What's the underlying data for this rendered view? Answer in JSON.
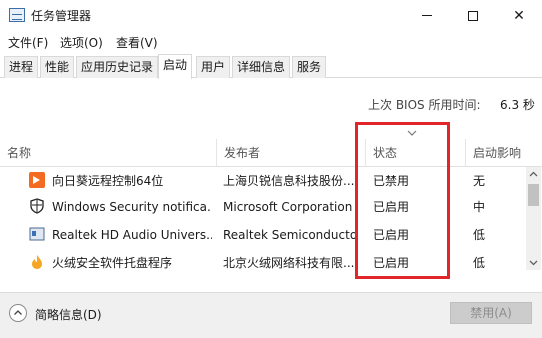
{
  "window": {
    "title": "任务管理器"
  },
  "menu": [
    "文件(F)",
    "选项(O)",
    "查看(V)"
  ],
  "tabs": [
    "进程",
    "性能",
    "应用历史记录",
    "启动",
    "用户",
    "详细信息",
    "服务"
  ],
  "active_tab": "启动",
  "boot": {
    "label": "上次 BIOS 所用时间:",
    "value": "6.3 秒"
  },
  "columns": {
    "name": "名称",
    "publisher": "发布者",
    "status": "状态",
    "impact": "启动影响"
  },
  "rows": [
    {
      "name": "向日葵远程控制64位",
      "publisher": "上海贝锐信息科技股份...",
      "status": "已禁用",
      "impact": "无",
      "icon": "sunflower-icon"
    },
    {
      "name": "Windows Security notifica...",
      "publisher": "Microsoft Corporation",
      "status": "已启用",
      "impact": "中",
      "icon": "shield-icon"
    },
    {
      "name": "Realtek HD Audio Univers...",
      "publisher": "Realtek Semiconductor",
      "status": "已启用",
      "impact": "低",
      "icon": "audio-icon"
    },
    {
      "name": "火绒安全软件托盘程序",
      "publisher": "北京火绒网络科技有限...",
      "status": "已启用",
      "impact": "低",
      "icon": "huorong-icon"
    }
  ],
  "bottom": {
    "details": "简略信息(D)",
    "disable": "禁用(A)"
  },
  "colors": {
    "highlight": "#e0252b",
    "sunflower": "#f26b21",
    "huorong": "#f5a623"
  }
}
